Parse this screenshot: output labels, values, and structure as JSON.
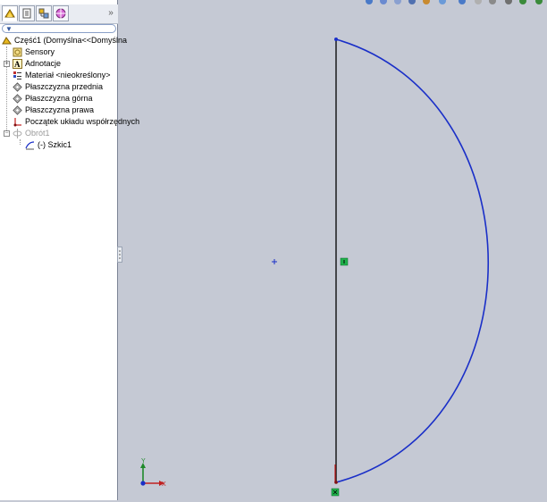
{
  "feature_tree": {
    "root": {
      "label": "Część1  (Domyślna<<Domyślna"
    },
    "items": [
      {
        "label": "Sensory",
        "icon": "sensors-icon"
      },
      {
        "label": "Adnotacje",
        "icon": "annotations-icon",
        "expandable": true
      },
      {
        "label": "Materiał <nieokreślony>",
        "icon": "material-icon"
      },
      {
        "label": "Płaszczyzna przednia",
        "icon": "plane-icon"
      },
      {
        "label": "Płaszczyzna górna",
        "icon": "plane-icon"
      },
      {
        "label": "Płaszczyzna prawa",
        "icon": "plane-icon"
      },
      {
        "label": "Początek układu współrzędnych",
        "icon": "origin-icon"
      },
      {
        "label": "Obrót1",
        "icon": "revolve-icon",
        "suppressed": true,
        "expanded": true
      },
      {
        "label": "(-) Szkic1",
        "icon": "sketch-icon",
        "child_of": "Obrót1"
      }
    ]
  },
  "panel_tabs": [
    "feature-manager",
    "property-manager",
    "configuration-manager",
    "dimxpert-manager"
  ],
  "triad": {
    "x_label": "X",
    "y_label": "Y"
  },
  "colors": {
    "sketch_curve": "#1a2fc8",
    "centerline": "#000000",
    "background": "#c5c9d4",
    "constraint": "#1fb14b"
  }
}
